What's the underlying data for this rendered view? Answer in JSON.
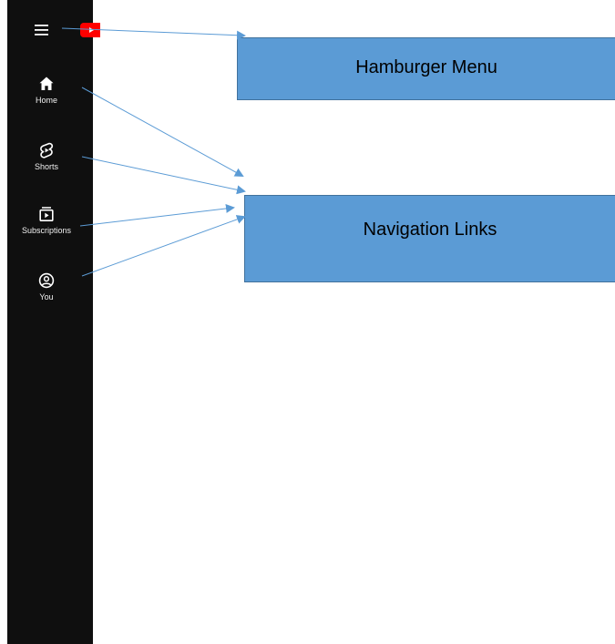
{
  "nav": {
    "items": [
      {
        "label": "Home",
        "icon": "home-icon"
      },
      {
        "label": "Shorts",
        "icon": "shorts-icon"
      },
      {
        "label": "Subscriptions",
        "icon": "subscriptions-icon"
      },
      {
        "label": "You",
        "icon": "you-icon"
      }
    ]
  },
  "annotations": {
    "hamburger_label": "Hamburger Menu",
    "nav_label": "Navigation Links"
  },
  "colors": {
    "sidebar_bg": "#0f0f0f",
    "brand_red": "#ff0000",
    "callout_fill": "#5b9bd5",
    "arrow": "#5b9bd5"
  }
}
